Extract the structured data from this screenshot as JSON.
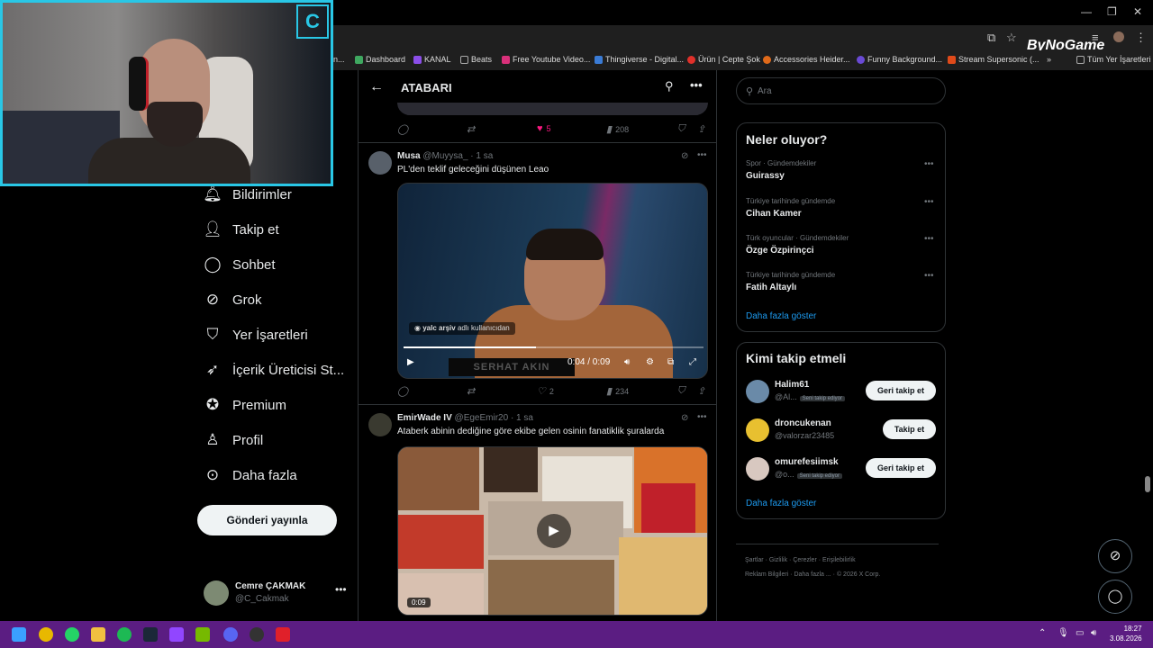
{
  "browser": {
    "bookmarks": [
      {
        "label": "n...",
        "color": "#444"
      },
      {
        "label": "Dashboard",
        "color": "#3fa860"
      },
      {
        "label": "KANAL",
        "color": "#8b4ee8"
      },
      {
        "label": "Beats",
        "color": "#999"
      },
      {
        "label": "Free Youtube Video...",
        "color": "#d9307a"
      },
      {
        "label": "Thingiverse - Digital...",
        "color": "#3a7bd5"
      },
      {
        "label": "Ürün | Cepte Şok",
        "color": "#e0302a"
      },
      {
        "label": "Accessories Heider...",
        "color": "#e06a1a"
      },
      {
        "label": "Funny Background...",
        "color": "#6a4ad5"
      },
      {
        "label": "Stream Supersonic (...",
        "color": "#e04a1a"
      },
      {
        "label": "Tüm Yer İşaretleri",
        "color": "#999"
      }
    ],
    "overlay_logo": "ByNoGame"
  },
  "nav": {
    "items": [
      {
        "label": "Bildirimler",
        "icon": "bell-icon"
      },
      {
        "label": "Takip et",
        "icon": "add-person-icon"
      },
      {
        "label": "Sohbet",
        "icon": "chat-icon"
      },
      {
        "label": "Grok",
        "icon": "grok-icon"
      },
      {
        "label": "Yer İşaretleri",
        "icon": "bookmark-icon"
      },
      {
        "label": "İçerik Üreticisi St...",
        "icon": "rocket-icon"
      },
      {
        "label": "Premium",
        "icon": "verified-icon"
      },
      {
        "label": "Profil",
        "icon": "person-icon"
      },
      {
        "label": "Daha fazla",
        "icon": "more-circle-icon"
      }
    ],
    "post_button": "Gönderi yayınla",
    "account": {
      "name": "Cemre ÇAKMAK",
      "handle": "@C_Cakmak"
    }
  },
  "timeline": {
    "title": "ATABARI",
    "prev_actions": {
      "likes": "5",
      "views": "208"
    },
    "tweet1": {
      "name": "Musa",
      "handle": "@Muyysa_",
      "time": "· 1 sa",
      "text": "PL'den teklif geleceğini düşünen Leao",
      "video_caption_user": "yalc arşiv",
      "video_caption_rest": "adlı kullanıcıdan",
      "video_time": "0:04 / 0:09",
      "video_band": "SERHAT AKIN",
      "progress": 0.44,
      "likes": "2",
      "views": "234"
    },
    "tweet2": {
      "name": "EmirWade IV",
      "handle": "@EgeEmir20",
      "time": "· 1 sa",
      "text": "Ataberk abinin dediğine göre ekibe gelen osinin fanatiklik şuralarda",
      "video_time": "0:09"
    }
  },
  "right": {
    "search_placeholder": "Ara",
    "trends_title": "Neler oluyor?",
    "trends": [
      {
        "meta": "Spor · Gündemdekiler",
        "name": "Guirassy"
      },
      {
        "meta": "Türkiye tarihinde gündemde",
        "name": "Cihan Kamer"
      },
      {
        "meta": "Türk oyuncular · Gündemdekiler",
        "name": "Özge Özpirinçci"
      },
      {
        "meta": "Türkiye tarihinde gündemde",
        "name": "Fatih Altaylı"
      }
    ],
    "show_more": "Daha fazla göster",
    "follow_title": "Kimi takip etmeli",
    "follow": [
      {
        "name": "Halim61",
        "handle": "@Al...",
        "badge": "Seni takip ediyor",
        "button": "Geri takip et"
      },
      {
        "name": "droncukenan",
        "handle": "@valorzar23485",
        "badge": "",
        "button": "Takip et"
      },
      {
        "name": "omurefesiimsk",
        "handle": "@o...",
        "badge": "Seni takip ediyor",
        "button": "Geri takip et"
      }
    ],
    "footer_row1": [
      "Şartlar",
      "Gizlilik",
      "Çerezler",
      "Erişilebilirlik"
    ],
    "footer_row2": [
      "Reklam Bilgileri",
      "Daha fazla ...",
      "© 2026 X Corp."
    ]
  },
  "taskbar": {
    "time": "18:27",
    "date": "3.08.2026"
  }
}
